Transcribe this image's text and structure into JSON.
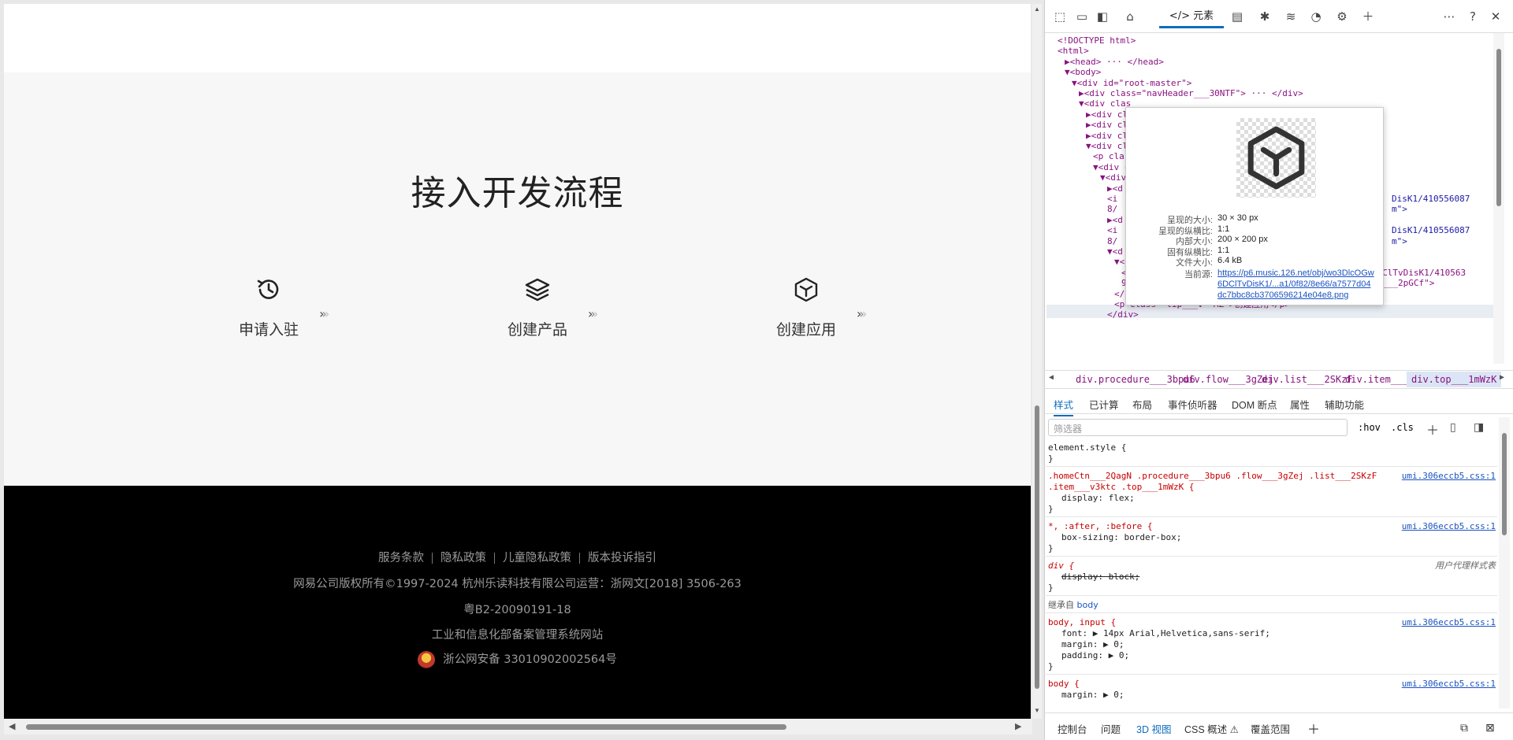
{
  "page": {
    "procedure_title": "接入开发流程",
    "flow": [
      {
        "label": "申请入驻",
        "icon": "clock-refresh-icon"
      },
      {
        "label": "创建产品",
        "icon": "layers-icon"
      },
      {
        "label": "创建应用",
        "icon": "cube-icon"
      }
    ],
    "footer": {
      "links": [
        "服务条款",
        "隐私政策",
        "儿童隐私政策",
        "版本投诉指引"
      ],
      "copyright": "网易公司版权所有©1997-2024   杭州乐读科技有限公司运营：浙网文[2018] 3506-263",
      "icp": "粤B2-20090191-18",
      "miit": "工业和信息化部备案管理系统网站",
      "police": "浙公网安备 33010902002564号"
    }
  },
  "devtools": {
    "toolbar": {
      "elements_tab": "元素"
    },
    "dom_lines": [
      {
        "t": "<!DOCTYPE html>",
        "indent": 0
      },
      {
        "t": "<html>",
        "indent": 0
      },
      {
        "t": "▶<head> ··· </head>",
        "indent": 1
      },
      {
        "t": "▼<body>",
        "indent": 1
      },
      {
        "t": "▼<div id=\"root-master\">",
        "indent": 2
      },
      {
        "t": "▶<div class=\"navHeader___30NTF\"> ··· </div>",
        "indent": 3
      },
      {
        "t": "▼<div clas",
        "indent": 3
      },
      {
        "t": "▶<div cla",
        "indent": 4
      },
      {
        "t": "▶<div cla",
        "indent": 4
      },
      {
        "t": "▶<div cla",
        "indent": 4
      },
      {
        "t": "▼<div cla",
        "indent": 4
      },
      {
        "t": "<p cla",
        "indent": 5
      },
      {
        "t": "▼<div c",
        "indent": 5
      },
      {
        "t": "▼<div",
        "indent": 6
      },
      {
        "t": "▶<d",
        "indent": 7
      },
      {
        "t": "<i",
        "indent": 7,
        "tail": "DisK1/410556087"
      },
      {
        "t": "8/",
        "indent": 7,
        "tail": "m\">"
      },
      {
        "t": "▶<d",
        "indent": 7
      },
      {
        "t": "<i",
        "indent": 7,
        "tail": "DisK1/410556087"
      },
      {
        "t": "8/",
        "indent": 7,
        "tail": "m\">"
      },
      {
        "t": "▼<d",
        "indent": 7
      },
      {
        "t": "▼<div class=\"top___1mWzK\"> flex == $0",
        "indent": 8
      },
      {
        "t": "<img src=\"https://p6.music.126.net/obj/wo3DlcOGw6DClTvDisK1/410563",
        "indent": 9
      },
      {
        "t": "9832/3da1/0f82/8e66/a7577d0...png\" class=\"itemIcon___2pGCf\">",
        "indent": 9
      },
      {
        "t": "</div>",
        "indent": 8
      },
      {
        "t": "<p class=\"tip___v--MZ\">创建应用</p>",
        "indent": 8
      },
      {
        "t": "</div>",
        "indent": 7
      }
    ],
    "popup": {
      "rows": [
        {
          "k": "呈现的大小:",
          "v": "30 × 30 px"
        },
        {
          "k": "呈现的纵横比:",
          "v": "1:1"
        },
        {
          "k": "内部大小:",
          "v": "200 × 200 px"
        },
        {
          "k": "固有纵横比:",
          "v": "1:1"
        },
        {
          "k": "文件大小:",
          "v": "6.4 kB"
        }
      ],
      "source_label": "当前源:",
      "source_url": "https://p6.music.126.net/obj/wo3DlcOGw6DClTvDisK1/...a1/0f82/8e66/a7577d04dc7bbc8cb3706596214e04e8.png"
    },
    "breadcrumb": [
      "div.procedure___3bpu6",
      "div.flow___3gZej",
      "div.list___2SKzF",
      "div.item___v3ktc",
      "div.top___1mWzK"
    ],
    "tabs": [
      "样式",
      "已计算",
      "布局",
      "事件侦听器",
      "DOM 断点",
      "属性",
      "辅助功能"
    ],
    "filter_placeholder": "筛选器",
    "filter_buttons": [
      ":hov",
      ".cls"
    ],
    "styles": {
      "element_style": "element.style {",
      "rule1_sel": ".homeCtn___2QagN .procedure___3bpu6 .flow___3gZej .list___2SKzF",
      "rule1_sel2": ".item___v3ktc .top___1mWzK {",
      "rule1_decl": "display: flex;",
      "rule1_src": "umi.306eccb5.css:1",
      "rule2_sel": "*, :after, :before {",
      "rule2_decl": "box-sizing: border-box;",
      "rule2_src": "umi.306eccb5.css:1",
      "rule3_sel": "div {",
      "rule3_decl": "display: block;",
      "rule3_ua": "用户代理样式表",
      "inherited": "继承自",
      "inherited_from": "body",
      "rule4_sel": "body, input {",
      "rule4_d1": "font: ▶ 14px Arial,Helvetica,sans-serif;",
      "rule4_d2": "margin: ▶ 0;",
      "rule4_d3": "padding: ▶ 0;",
      "rule4_src": "umi.306eccb5.css:1",
      "rule5_sel": "body {",
      "rule5_d1": "margin: ▶ 0;",
      "rule5_src": "umi.306eccb5.css:1"
    },
    "drawer_tabs": [
      "控制台",
      "问题",
      "3D 视图",
      "CSS 概述 ⚠",
      "覆盖范围"
    ]
  }
}
